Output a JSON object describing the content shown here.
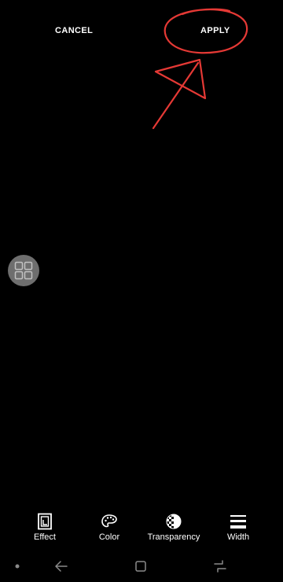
{
  "header": {
    "cancel_label": "CANCEL",
    "apply_label": "APPLY"
  },
  "annotation": {
    "color": "#e53935",
    "shapes": [
      "circle-around-apply",
      "arrow-pointing-to-apply"
    ]
  },
  "floating_handle": {
    "icon": "grid-icon",
    "color": "#7a7a7a"
  },
  "toolbar": {
    "items": [
      {
        "label": "Effect",
        "icon": "effect-icon"
      },
      {
        "label": "Color",
        "icon": "palette-icon"
      },
      {
        "label": "Transparency",
        "icon": "transparency-icon"
      },
      {
        "label": "Width",
        "icon": "width-icon"
      }
    ]
  },
  "navbar": {
    "items": [
      "dot-icon",
      "back-icon",
      "home-icon",
      "recent-apps-icon"
    ]
  }
}
